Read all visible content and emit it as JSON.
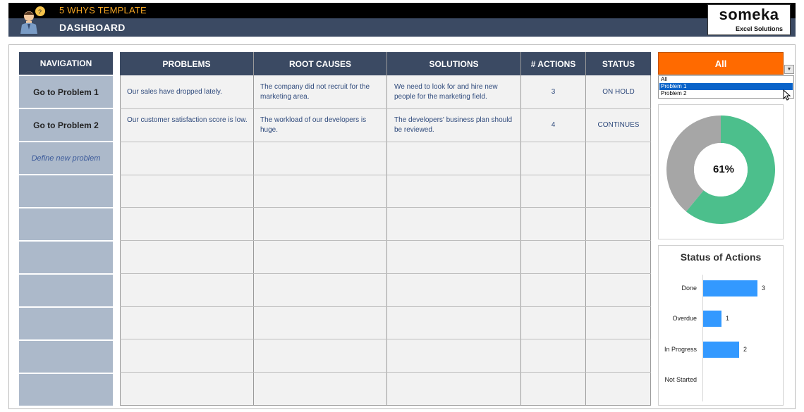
{
  "header": {
    "app_title": "5 WHYS TEMPLATE",
    "page_title": "DASHBOARD",
    "logo_main": "someka",
    "logo_sub": "Excel Solutions"
  },
  "navigation": {
    "header": "NAVIGATION",
    "items": [
      {
        "label": "Go to Problem 1"
      },
      {
        "label": "Go to Problem 2"
      },
      {
        "label": "Define new problem"
      }
    ]
  },
  "table": {
    "columns": [
      "PROBLEMS",
      "ROOT CAUSES",
      "SOLUTIONS",
      "# ACTIONS",
      "STATUS"
    ],
    "rows": [
      {
        "problem": "Our sales have dropped lately.",
        "root_cause": "The company did not recruit for the marketing area.",
        "solution": "We need to look for and hire new people for the marketing field.",
        "actions": "3",
        "status": "ON HOLD"
      },
      {
        "problem": "Our customer satisfaction score is low.",
        "root_cause": "The workload of our developers is huge.",
        "solution": "The developers' business plan should be reviewed.",
        "actions": "4",
        "status": "CONTINUES"
      }
    ]
  },
  "filter": {
    "selected": "All",
    "options": [
      "All",
      "Problem 1",
      "Problem 2"
    ],
    "highlighted": "Problem 1"
  },
  "donut": {
    "label": "61%",
    "value": 0.61,
    "colors": {
      "primary": "#4cbf8c",
      "rest": "#a6a6a6"
    }
  },
  "status_chart": {
    "title": "Status of Actions",
    "categories": [
      "Done",
      "Overdue",
      "In Progress",
      "Not Started"
    ],
    "values": [
      3,
      1,
      2,
      0
    ],
    "value_labels": [
      "3",
      "1",
      "2",
      ""
    ],
    "color": "#3399ff"
  },
  "chart_data": [
    {
      "type": "pie",
      "values": [
        61,
        39
      ],
      "labels": [
        "61%"
      ],
      "colors": [
        "#4cbf8c",
        "#a6a6a6"
      ]
    },
    {
      "type": "bar",
      "title": "Status of Actions",
      "categories": [
        "Done",
        "Overdue",
        "In Progress",
        "Not Started"
      ],
      "values": [
        3,
        1,
        2,
        0
      ],
      "orientation": "horizontal",
      "grid": false
    }
  ]
}
